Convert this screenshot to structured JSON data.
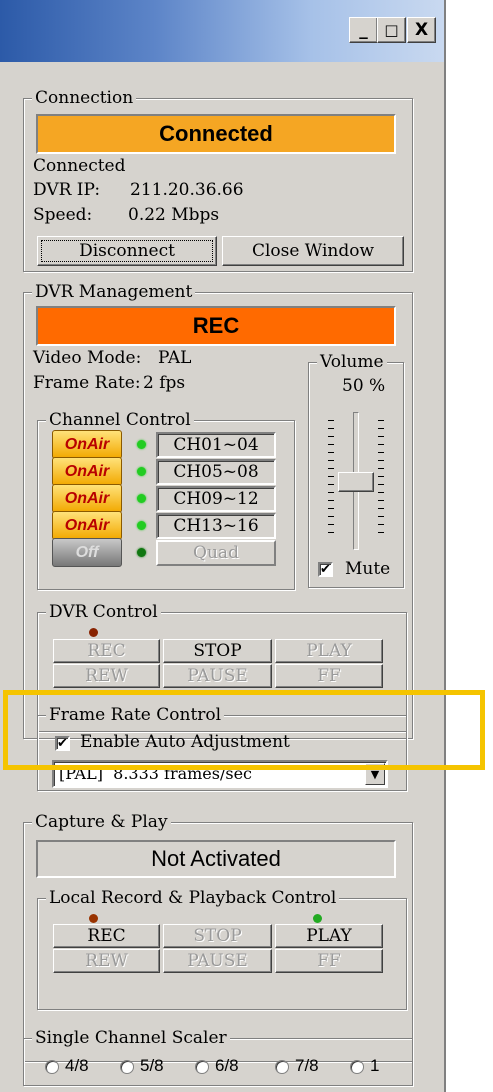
{
  "window": {
    "buttons": {
      "minimize": "_",
      "maximize": "□",
      "close": "X"
    }
  },
  "connection": {
    "legend": "Connection",
    "banner": "Connected",
    "banner_color": "#f5a623",
    "status": "Connected",
    "dvr_ip_label": "DVR IP:",
    "dvr_ip": "211.20.36.66",
    "speed_label": "Speed:",
    "speed": "0.22 Mbps",
    "disconnect": "Disconnect",
    "close_window": "Close Window"
  },
  "dvr_management": {
    "legend": "DVR Management",
    "banner": "REC",
    "banner_color": "#ff6a00",
    "video_mode_label": "Video Mode:",
    "video_mode": "PAL",
    "frame_rate_label": "Frame Rate:",
    "frame_rate": "2 fps",
    "volume": {
      "legend": "Volume",
      "value": "50 %",
      "level": 0.5,
      "mute_label": "Mute",
      "mute_checked": true
    },
    "channel_control": {
      "legend": "Channel Control",
      "rows": [
        {
          "state": "OnAir",
          "channel": "CH01~04",
          "led": "#22cc22"
        },
        {
          "state": "OnAir",
          "channel": "CH05~08",
          "led": "#22cc22"
        },
        {
          "state": "OnAir",
          "channel": "CH09~12",
          "led": "#22cc22"
        },
        {
          "state": "OnAir",
          "channel": "CH13~16",
          "led": "#22cc22"
        },
        {
          "state": "Off",
          "channel": "Quad",
          "led": "#117711"
        }
      ]
    },
    "dvr_control": {
      "legend": "DVR Control",
      "led": "#882200",
      "row1": [
        "REC",
        "STOP",
        "PLAY"
      ],
      "row2": [
        "REW",
        "PAUSE",
        "FF"
      ]
    }
  },
  "frame_rate_control": {
    "legend": "Frame Rate Control",
    "auto_label": "Enable Auto Adjustment",
    "auto_checked": true,
    "selected": "[PAL]  8.333 frames/sec",
    "highlight_color": "#f5c400"
  },
  "capture_play": {
    "legend": "Capture & Play",
    "banner": "Not Activated",
    "local": {
      "legend": "Local Record & Playback Control",
      "rec_led": "#993300",
      "play_led": "#22aa22",
      "row1": [
        "REC",
        "STOP",
        "PLAY"
      ],
      "row2": [
        "REW",
        "PAUSE",
        "FF"
      ]
    }
  },
  "scaler": {
    "legend": "Single Channel Scaler",
    "options": [
      "4/8",
      "5/8",
      "6/8",
      "7/8",
      "1"
    ]
  }
}
